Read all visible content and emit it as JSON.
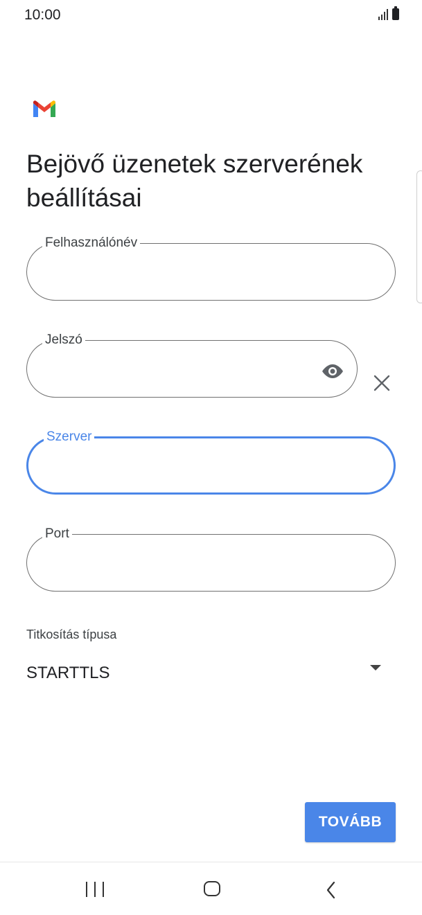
{
  "status_bar": {
    "time": "10:00",
    "icons": [
      "signal-icon",
      "battery-icon"
    ]
  },
  "app": {
    "logo": "gmail-logo-icon"
  },
  "title": "Bejövő üzenetek szerverének beállításai",
  "fields": {
    "username": {
      "label": "Felhasználónév",
      "value": ""
    },
    "password": {
      "label": "Jelszó",
      "value": ""
    },
    "server": {
      "label": "Szerver",
      "value": ""
    },
    "port": {
      "label": "Port",
      "value": ""
    }
  },
  "encryption": {
    "label": "Titkosítás típusa",
    "selected": "STARTTLS"
  },
  "buttons": {
    "next": "TOVÁBB"
  },
  "colors": {
    "accent": "#4a86e8",
    "outline": "#6f6f6f"
  },
  "nav": {
    "icons": [
      "recents-icon",
      "home-icon",
      "back-icon"
    ]
  }
}
